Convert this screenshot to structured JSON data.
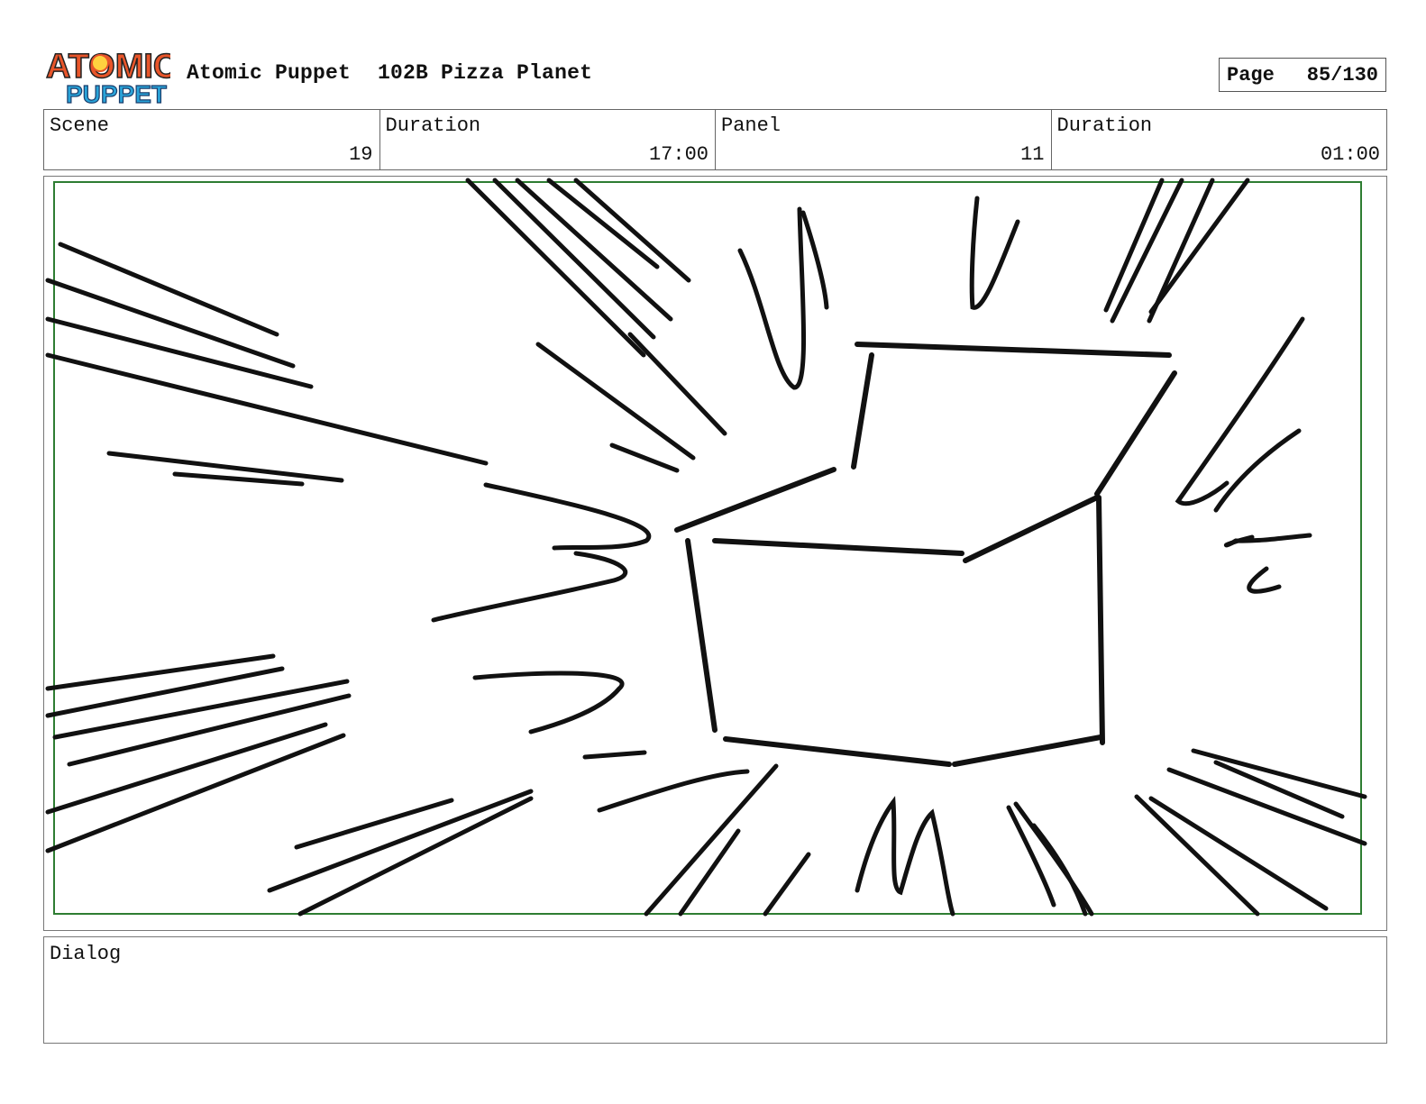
{
  "header": {
    "logo_text_top": "ATOMIC",
    "logo_text_bottom": "PUPPET",
    "studio": "Atomic Puppet",
    "episode": "102B Pizza Planet",
    "page_label": "Page",
    "page_value": "85/130"
  },
  "info": {
    "scene_label": "Scene",
    "scene_value": "19",
    "scene_duration_label": "Duration",
    "scene_duration_value": "17:00",
    "panel_label": "Panel",
    "panel_value": "11",
    "panel_duration_label": "Duration",
    "panel_duration_value": "01:00"
  },
  "dialog": {
    "label": "Dialog",
    "text": ""
  },
  "colors": {
    "safe_frame": "#2e7d32",
    "logo_orange": "#e8552a",
    "logo_blue": "#29a3d8",
    "ink": "#111111"
  }
}
